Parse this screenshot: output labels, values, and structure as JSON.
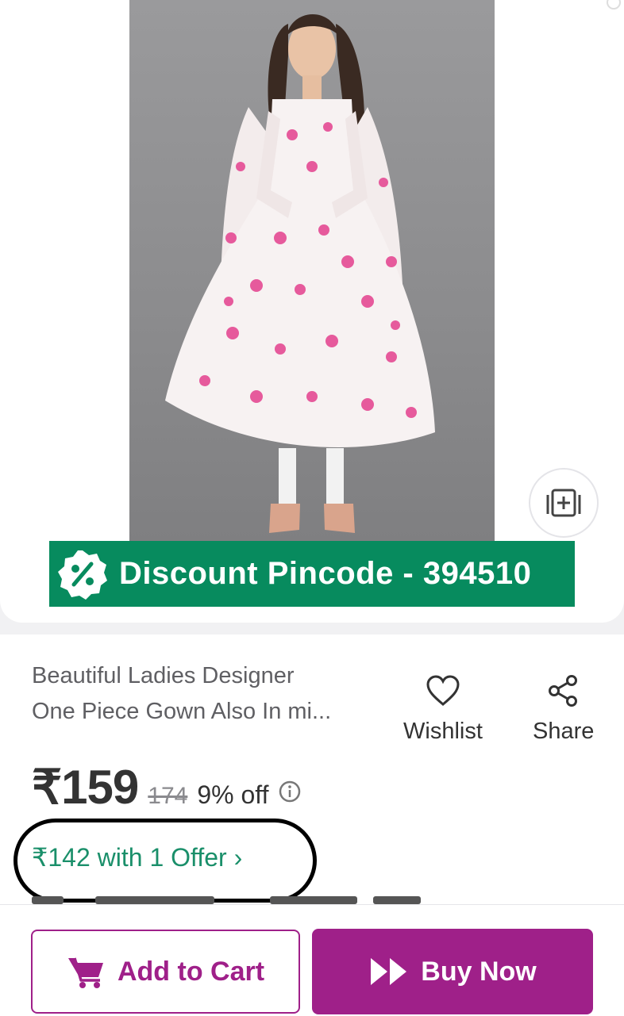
{
  "product": {
    "title_line1": "Beautiful Ladies Designer",
    "title_line2": "One Piece Gown Also In mi...",
    "image_alt": "Model wearing white gown with pink floral print and matching dupatta"
  },
  "banner": {
    "text": "Discount Pincode - 394510",
    "background": "#078b5e",
    "badge_icon": "percent-badge-icon"
  },
  "actions": {
    "wishlist_label": "Wishlist",
    "share_label": "Share"
  },
  "price": {
    "current": "₹159",
    "mrp": "174",
    "discount": "9% off"
  },
  "offer": {
    "text": "₹142 with 1 Offer ›",
    "color": "#1a8f6a"
  },
  "footer": {
    "cart_label": "Add to Cart",
    "buy_label": "Buy Now",
    "accent": "#9f2089"
  },
  "icons": {
    "compare": "add-to-compare-icon",
    "wishlist": "heart-icon",
    "share": "share-icon",
    "info": "info-icon",
    "cart": "cart-icon",
    "buy": "fast-forward-icon"
  }
}
